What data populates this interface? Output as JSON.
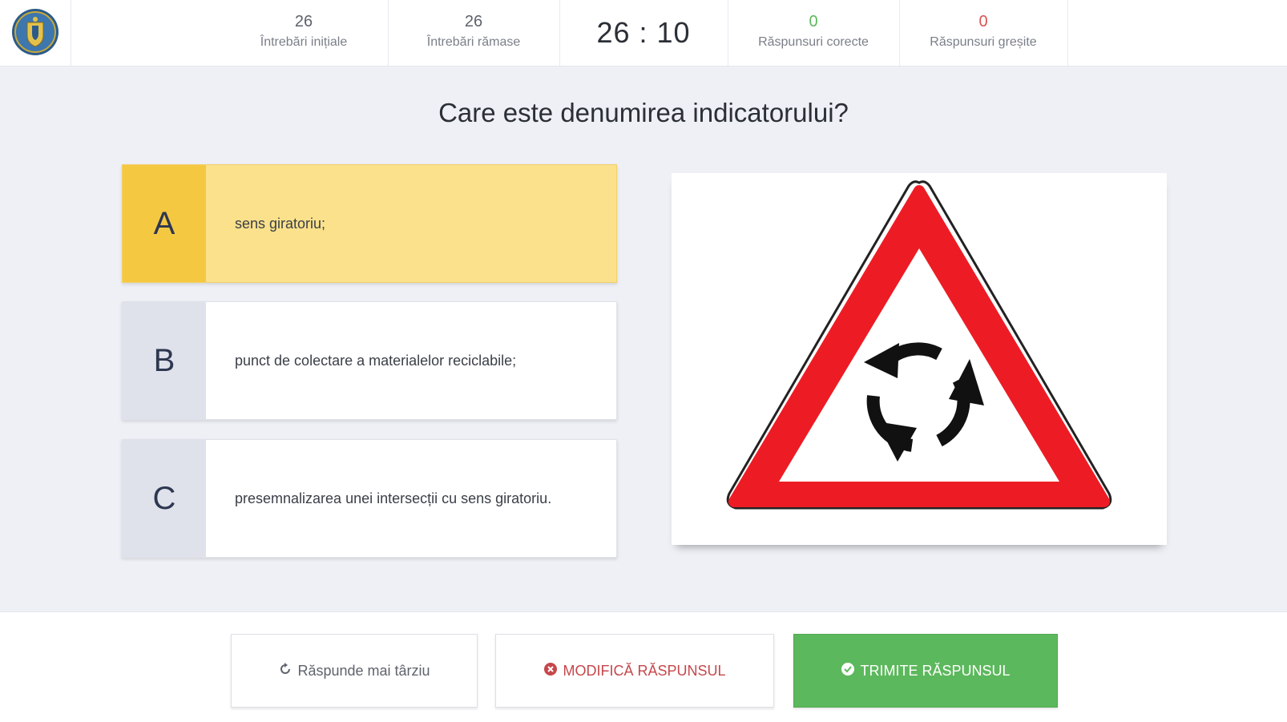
{
  "header": {
    "stats": [
      {
        "value": "26",
        "label": "Întrebări inițiale"
      },
      {
        "value": "26",
        "label": "Întrebări rămase"
      },
      {
        "value": "0",
        "label": "Răspunsuri corecte"
      },
      {
        "value": "0",
        "label": "Răspunsuri greșite"
      }
    ],
    "timer": "26 : 10",
    "colors": {
      "correct": "#5cb85c",
      "wrong": "#d9534f"
    }
  },
  "question": {
    "text": "Care este denumirea indicatorului?"
  },
  "answers": [
    {
      "letter": "A",
      "text": "sens giratoriu;",
      "selected": true
    },
    {
      "letter": "B",
      "text": "punct de colectare a materialelor reciclabile;",
      "selected": false
    },
    {
      "letter": "C",
      "text": "presemnalizarea unei intersecții cu sens giratoriu.",
      "selected": false
    }
  ],
  "image": {
    "icon": "roundabout-warning-sign",
    "colors": {
      "border": "#ed1c24",
      "fill": "#ffffff",
      "arrows": "#111111"
    }
  },
  "actions": {
    "later_label": "Răspunde mai târziu",
    "modify_label": "MODIFICĂ RĂSPUNSUL",
    "submit_label": "TRIMITE RĂSPUNSUL",
    "colors": {
      "submit": "#5cb85c",
      "modify": "#c6474b"
    }
  }
}
